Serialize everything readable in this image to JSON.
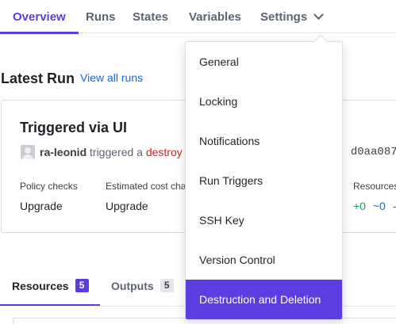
{
  "nav": {
    "tabs": [
      {
        "label": "Overview"
      },
      {
        "label": "Runs"
      },
      {
        "label": "States"
      },
      {
        "label": "Variables"
      },
      {
        "label": "Settings"
      }
    ],
    "active_tab": "Overview",
    "settings_icon": "chevron-down-icon"
  },
  "latest_run": {
    "heading": "Latest Run",
    "view_all_link": "View all runs",
    "title": "Triggered via UI",
    "user": "ra-leonid",
    "action_text": "triggered a",
    "action_type": "destroy",
    "commit_arrow": "-",
    "commit": "d0aa087",
    "stats": {
      "policy_label": "Policy checks",
      "policy_value": "Upgrade",
      "cost_label": "Estimated cost cha",
      "cost_value": "Upgrade",
      "resources_label": "Resources",
      "resources_add": "+0",
      "resources_change": "~0",
      "resources_destroy": "-"
    }
  },
  "bottom_tabs": [
    {
      "label": "Resources",
      "count": "5"
    },
    {
      "label": "Outputs",
      "count": "5"
    }
  ],
  "settings_menu": {
    "items": [
      {
        "label": "General"
      },
      {
        "label": "Locking"
      },
      {
        "label": "Notifications"
      },
      {
        "label": "Run Triggers"
      },
      {
        "label": "SSH Key"
      },
      {
        "label": "Version Control"
      },
      {
        "label": "Destruction and Deletion"
      }
    ],
    "highlighted": "Destruction and Deletion"
  },
  "colors": {
    "accent": "#5b3de0",
    "link": "#1a66d9",
    "destroy": "#c42b2b",
    "add": "#1f9d55"
  }
}
